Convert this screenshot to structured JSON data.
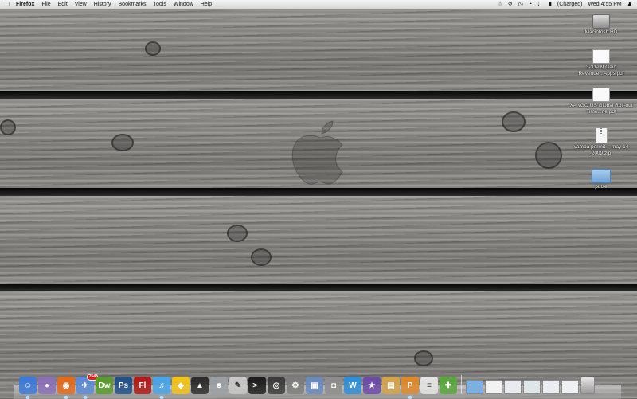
{
  "menubar": {
    "apple_icon": "apple-logo",
    "app_name": "Firefox",
    "menus": [
      "File",
      "Edit",
      "View",
      "History",
      "Bookmarks",
      "Tools",
      "Window",
      "Help"
    ],
    "battery_status": "(Charged)",
    "clock": "Wed 4:55 PM"
  },
  "desktop": {
    "icons": [
      {
        "label": "Macintosh HD",
        "kind": "hard-drive"
      },
      {
        "label": "3-31-09 Gain Revenue...Apps.pdf",
        "kind": "pdf-document"
      },
      {
        "label": "XANGO US Global Roll-out Time...ne.pdf",
        "kind": "pdf-document"
      },
      {
        "label": "vampa permit -- may 14 2009.zip",
        "kind": "zip-archive"
      },
      {
        "label": "pulse",
        "kind": "folder"
      }
    ]
  },
  "dock": {
    "badge": "754",
    "items": [
      {
        "name": "finder",
        "glyph": "☺",
        "color": "#3b7ad8"
      },
      {
        "name": "pidgin",
        "glyph": "●",
        "color": "#8b6fb8"
      },
      {
        "name": "firefox",
        "glyph": "◉",
        "color": "#e66a1b"
      },
      {
        "name": "mail",
        "glyph": "✈",
        "color": "#5b8bd6"
      },
      {
        "name": "dreamweaver",
        "glyph": "Dw",
        "color": "#5a9a2a"
      },
      {
        "name": "photoshop",
        "glyph": "Ps",
        "color": "#1f4f8a"
      },
      {
        "name": "flash",
        "glyph": "Fl",
        "color": "#b01818"
      },
      {
        "name": "itunes",
        "glyph": "♫",
        "color": "#4aa5e8"
      },
      {
        "name": "cyberduck",
        "glyph": "◆",
        "color": "#f4c418"
      },
      {
        "name": "twitter-bird",
        "glyph": "▲",
        "color": "#2b2b2b"
      },
      {
        "name": "automator",
        "glyph": "☻",
        "color": "#9aa0a6"
      },
      {
        "name": "preview-pencil",
        "glyph": "✎",
        "color": "#c9c9c9"
      },
      {
        "name": "terminal",
        "glyph": ">_",
        "color": "#1b1b1b"
      },
      {
        "name": "dashboard",
        "glyph": "◎",
        "color": "#3a3a3a"
      },
      {
        "name": "system-preferences",
        "glyph": "⚙",
        "color": "#7d7d7d"
      },
      {
        "name": "iphoto",
        "glyph": "▣",
        "color": "#6a8ac0"
      },
      {
        "name": "camera",
        "glyph": "◘",
        "color": "#8d8d8d"
      },
      {
        "name": "itunes-u",
        "glyph": "W",
        "color": "#2d8fd8"
      },
      {
        "name": "imovie",
        "glyph": "★",
        "color": "#6c4aa8"
      },
      {
        "name": "image-capture",
        "glyph": "▤",
        "color": "#d7a44a"
      },
      {
        "name": "pages",
        "glyph": "P",
        "color": "#e08a2a"
      },
      {
        "name": "textedit",
        "glyph": "≡",
        "color": "#e6e6e6"
      },
      {
        "name": "script-editor",
        "glyph": "✚",
        "color": "#58a83a"
      }
    ],
    "right_items": [
      {
        "name": "applications-stack",
        "color": "#7bb0e0"
      },
      {
        "name": "document-stack",
        "color": "#f2f2f2"
      },
      {
        "name": "window-1",
        "color": "#e8ecf0"
      },
      {
        "name": "window-2",
        "color": "#dfe6ea"
      },
      {
        "name": "window-3",
        "color": "#e9edf2"
      },
      {
        "name": "window-4",
        "color": "#edf1f4"
      },
      {
        "name": "trash",
        "color": "#c8c8c8"
      }
    ]
  }
}
